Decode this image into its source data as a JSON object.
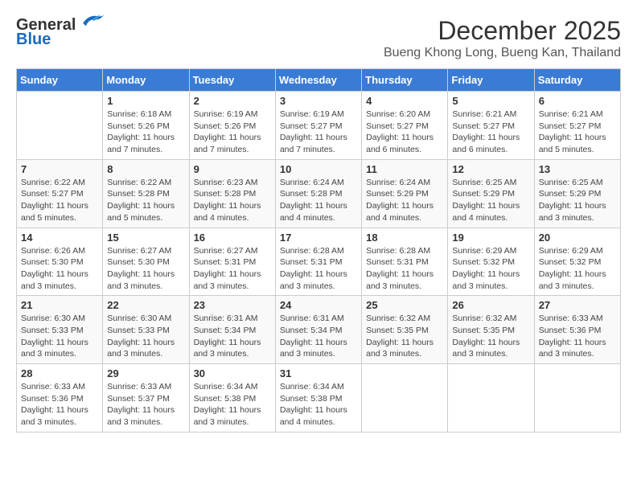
{
  "logo": {
    "general": "General",
    "blue": "Blue"
  },
  "title": {
    "month_year": "December 2025",
    "location": "Bueng Khong Long, Bueng Kan, Thailand"
  },
  "calendar": {
    "days_of_week": [
      "Sunday",
      "Monday",
      "Tuesday",
      "Wednesday",
      "Thursday",
      "Friday",
      "Saturday"
    ],
    "weeks": [
      [
        {
          "day": "",
          "info": ""
        },
        {
          "day": "1",
          "info": "Sunrise: 6:18 AM\nSunset: 5:26 PM\nDaylight: 11 hours and 7 minutes."
        },
        {
          "day": "2",
          "info": "Sunrise: 6:19 AM\nSunset: 5:26 PM\nDaylight: 11 hours and 7 minutes."
        },
        {
          "day": "3",
          "info": "Sunrise: 6:19 AM\nSunset: 5:27 PM\nDaylight: 11 hours and 7 minutes."
        },
        {
          "day": "4",
          "info": "Sunrise: 6:20 AM\nSunset: 5:27 PM\nDaylight: 11 hours and 6 minutes."
        },
        {
          "day": "5",
          "info": "Sunrise: 6:21 AM\nSunset: 5:27 PM\nDaylight: 11 hours and 6 minutes."
        },
        {
          "day": "6",
          "info": "Sunrise: 6:21 AM\nSunset: 5:27 PM\nDaylight: 11 hours and 5 minutes."
        }
      ],
      [
        {
          "day": "7",
          "info": "Sunrise: 6:22 AM\nSunset: 5:27 PM\nDaylight: 11 hours and 5 minutes."
        },
        {
          "day": "8",
          "info": "Sunrise: 6:22 AM\nSunset: 5:28 PM\nDaylight: 11 hours and 5 minutes."
        },
        {
          "day": "9",
          "info": "Sunrise: 6:23 AM\nSunset: 5:28 PM\nDaylight: 11 hours and 4 minutes."
        },
        {
          "day": "10",
          "info": "Sunrise: 6:24 AM\nSunset: 5:28 PM\nDaylight: 11 hours and 4 minutes."
        },
        {
          "day": "11",
          "info": "Sunrise: 6:24 AM\nSunset: 5:29 PM\nDaylight: 11 hours and 4 minutes."
        },
        {
          "day": "12",
          "info": "Sunrise: 6:25 AM\nSunset: 5:29 PM\nDaylight: 11 hours and 4 minutes."
        },
        {
          "day": "13",
          "info": "Sunrise: 6:25 AM\nSunset: 5:29 PM\nDaylight: 11 hours and 3 minutes."
        }
      ],
      [
        {
          "day": "14",
          "info": "Sunrise: 6:26 AM\nSunset: 5:30 PM\nDaylight: 11 hours and 3 minutes."
        },
        {
          "day": "15",
          "info": "Sunrise: 6:27 AM\nSunset: 5:30 PM\nDaylight: 11 hours and 3 minutes."
        },
        {
          "day": "16",
          "info": "Sunrise: 6:27 AM\nSunset: 5:31 PM\nDaylight: 11 hours and 3 minutes."
        },
        {
          "day": "17",
          "info": "Sunrise: 6:28 AM\nSunset: 5:31 PM\nDaylight: 11 hours and 3 minutes."
        },
        {
          "day": "18",
          "info": "Sunrise: 6:28 AM\nSunset: 5:31 PM\nDaylight: 11 hours and 3 minutes."
        },
        {
          "day": "19",
          "info": "Sunrise: 6:29 AM\nSunset: 5:32 PM\nDaylight: 11 hours and 3 minutes."
        },
        {
          "day": "20",
          "info": "Sunrise: 6:29 AM\nSunset: 5:32 PM\nDaylight: 11 hours and 3 minutes."
        }
      ],
      [
        {
          "day": "21",
          "info": "Sunrise: 6:30 AM\nSunset: 5:33 PM\nDaylight: 11 hours and 3 minutes."
        },
        {
          "day": "22",
          "info": "Sunrise: 6:30 AM\nSunset: 5:33 PM\nDaylight: 11 hours and 3 minutes."
        },
        {
          "day": "23",
          "info": "Sunrise: 6:31 AM\nSunset: 5:34 PM\nDaylight: 11 hours and 3 minutes."
        },
        {
          "day": "24",
          "info": "Sunrise: 6:31 AM\nSunset: 5:34 PM\nDaylight: 11 hours and 3 minutes."
        },
        {
          "day": "25",
          "info": "Sunrise: 6:32 AM\nSunset: 5:35 PM\nDaylight: 11 hours and 3 minutes."
        },
        {
          "day": "26",
          "info": "Sunrise: 6:32 AM\nSunset: 5:35 PM\nDaylight: 11 hours and 3 minutes."
        },
        {
          "day": "27",
          "info": "Sunrise: 6:33 AM\nSunset: 5:36 PM\nDaylight: 11 hours and 3 minutes."
        }
      ],
      [
        {
          "day": "28",
          "info": "Sunrise: 6:33 AM\nSunset: 5:36 PM\nDaylight: 11 hours and 3 minutes."
        },
        {
          "day": "29",
          "info": "Sunrise: 6:33 AM\nSunset: 5:37 PM\nDaylight: 11 hours and 3 minutes."
        },
        {
          "day": "30",
          "info": "Sunrise: 6:34 AM\nSunset: 5:38 PM\nDaylight: 11 hours and 3 minutes."
        },
        {
          "day": "31",
          "info": "Sunrise: 6:34 AM\nSunset: 5:38 PM\nDaylight: 11 hours and 4 minutes."
        },
        {
          "day": "",
          "info": ""
        },
        {
          "day": "",
          "info": ""
        },
        {
          "day": "",
          "info": ""
        }
      ]
    ]
  }
}
